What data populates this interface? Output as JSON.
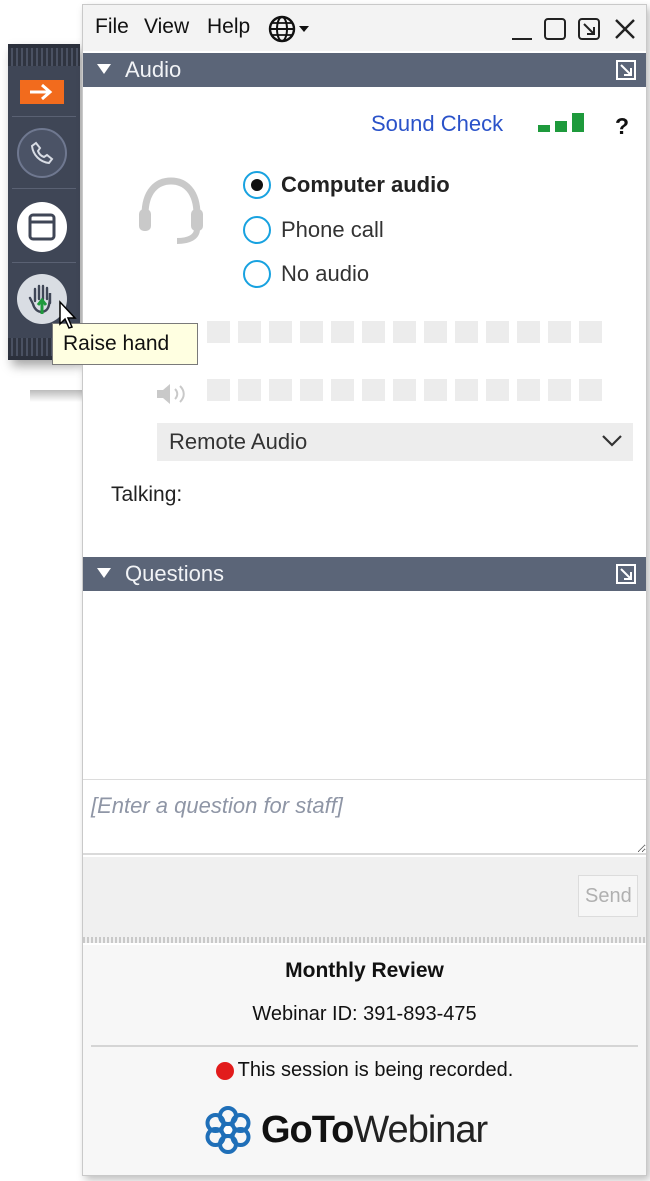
{
  "menubar": {
    "items": [
      "File",
      "View",
      "Help"
    ]
  },
  "audio_panel": {
    "title": "Audio",
    "sound_check": "Sound Check",
    "help": "?",
    "options": [
      {
        "label": "Computer audio",
        "selected": true
      },
      {
        "label": "Phone call",
        "selected": false
      },
      {
        "label": "No audio",
        "selected": false
      }
    ],
    "device_select": "Remote Audio",
    "talking_label": "Talking:"
  },
  "questions_panel": {
    "title": "Questions",
    "input_placeholder": "[Enter a question for staff]",
    "send_label": "Send"
  },
  "footer": {
    "session_title": "Monthly Review",
    "webinar_id": "Webinar ID: 391-893-475",
    "recording_notice": "This session is being recorded.",
    "brand_goto": "GoTo",
    "brand_webinar": "Webinar"
  },
  "control_strip": {
    "tooltip": "Raise hand"
  },
  "icons": {
    "globe": "globe-icon",
    "minimize": "minimize-icon",
    "maximize": "maximize-icon",
    "popout": "popout-icon",
    "close": "close-icon",
    "headset": "headset-icon",
    "speaker": "speaker-icon",
    "signal": "signal-bars-icon"
  },
  "colors": {
    "panel_header": "#5b6578",
    "link": "#2a52c9",
    "radio_ring": "#18a2e0",
    "signal_green": "#1e9a3c",
    "recording_red": "#e21b1b",
    "strip_orange": "#f26b1d"
  }
}
